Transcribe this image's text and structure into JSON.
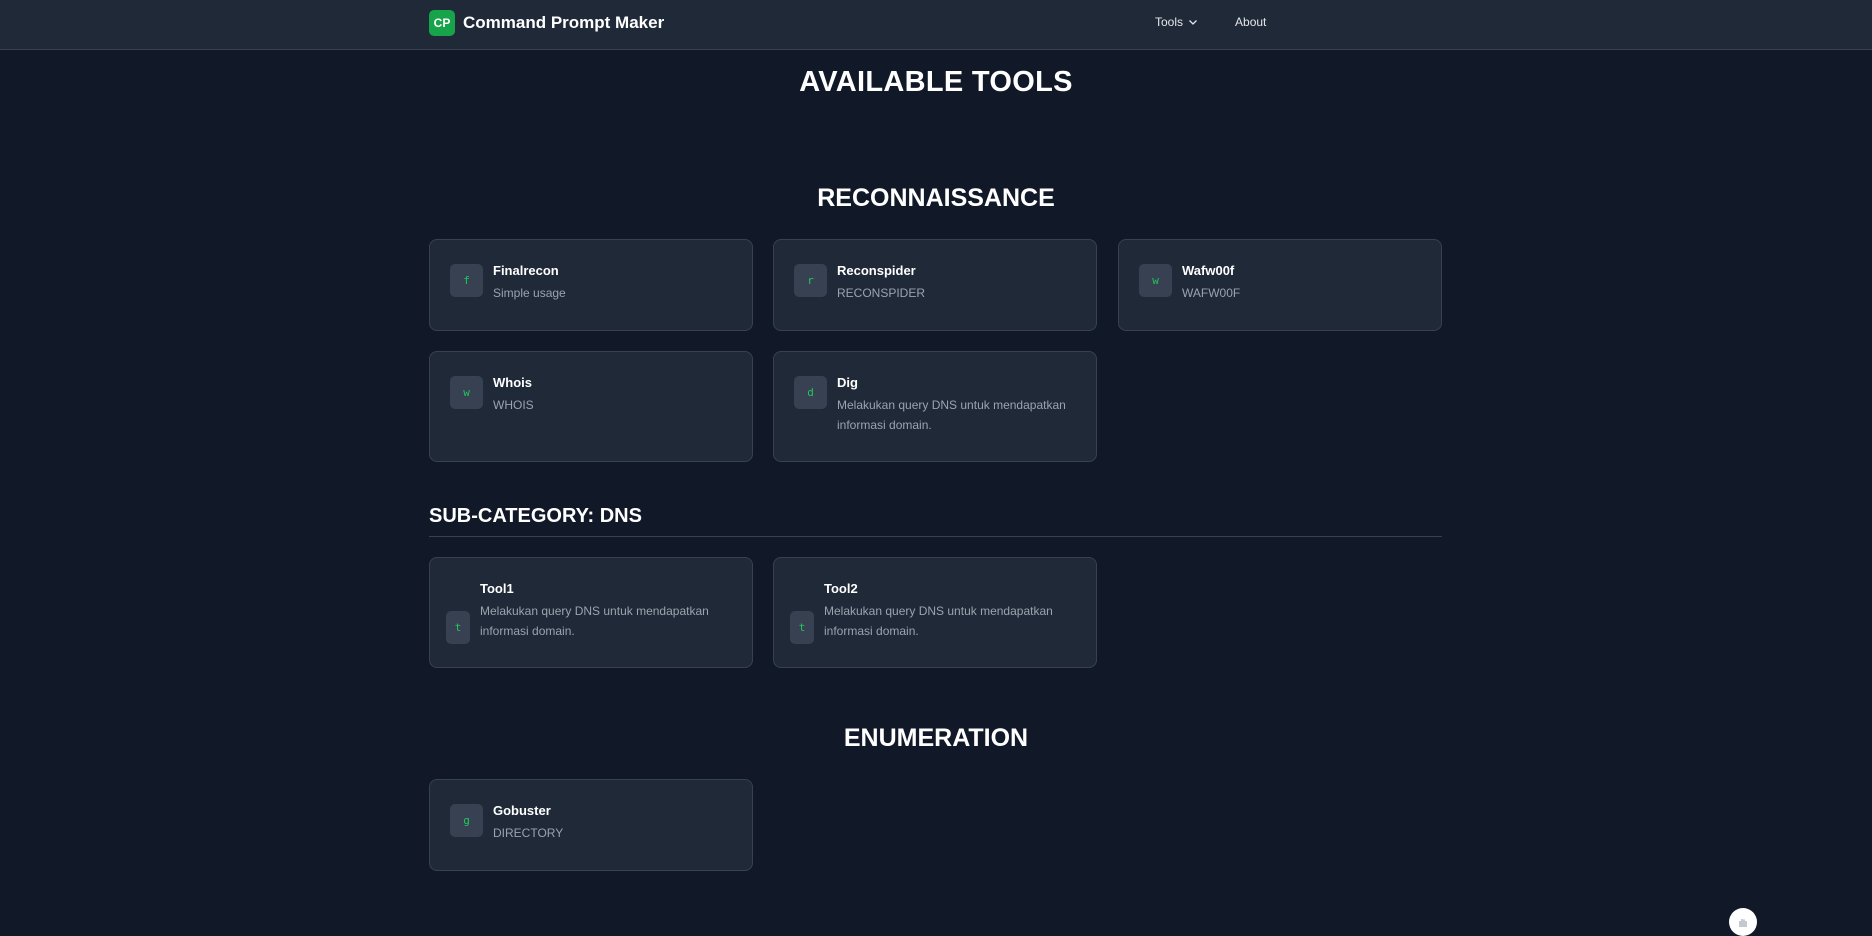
{
  "nav": {
    "logo": "CP",
    "brand": "Command Prompt Maker",
    "tools_label": "Tools",
    "about_label": "About"
  },
  "page_title": "AVAILABLE TOOLS",
  "categories": [
    {
      "title": "RECONNAISSANCE",
      "tools": [
        {
          "icon": "f",
          "name": "Finalrecon",
          "desc": "Simple usage"
        },
        {
          "icon": "r",
          "name": "Reconspider",
          "desc": "RECONSPIDER"
        },
        {
          "icon": "w",
          "name": "Wafw00f",
          "desc": "WAFW00F"
        },
        {
          "icon": "w",
          "name": "Whois",
          "desc": "WHOIS"
        },
        {
          "icon": "d",
          "name": "Dig",
          "desc": "Melakukan query DNS untuk mendapatkan informasi domain."
        }
      ],
      "subcategory": {
        "title": "SUB-CATEGORY: DNS",
        "tools": [
          {
            "icon": "t",
            "name": "Tool1",
            "desc": "Melakukan query DNS untuk mendapatkan informasi domain."
          },
          {
            "icon": "t",
            "name": "Tool2",
            "desc": "Melakukan query DNS untuk mendapatkan informasi domain."
          }
        ]
      }
    },
    {
      "title": "ENUMERATION",
      "tools": [
        {
          "icon": "g",
          "name": "Gobuster",
          "desc": "DIRECTORY"
        }
      ]
    }
  ],
  "colors": {
    "background": "#111827",
    "card": "#1f2937",
    "accent": "#22c55e",
    "logo": "#16a34a"
  }
}
